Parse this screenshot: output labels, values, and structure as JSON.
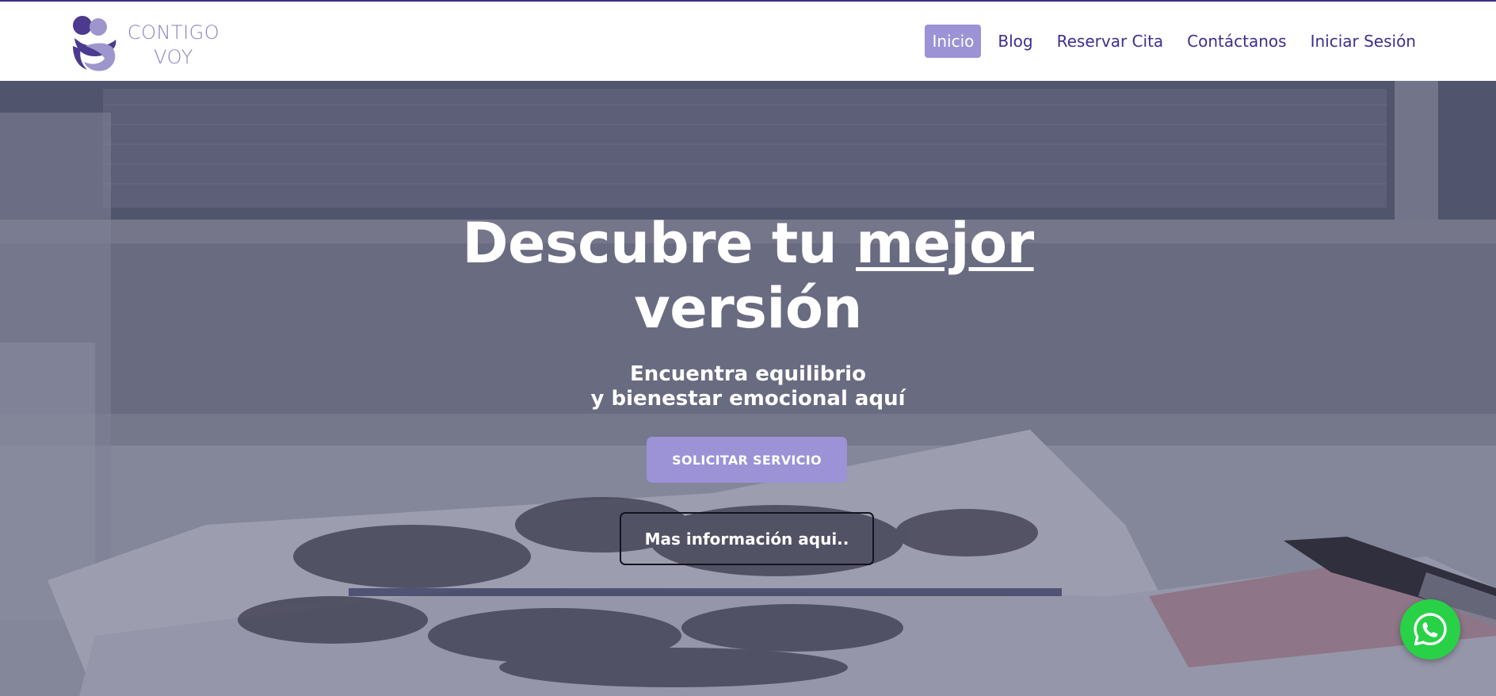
{
  "brand": {
    "line1": "CONTIGO",
    "line2": "VOY",
    "color": "#8a7fc2"
  },
  "nav": {
    "items": [
      {
        "label": "Inicio",
        "active": true
      },
      {
        "label": "Blog",
        "active": false
      },
      {
        "label": "Reservar Cita",
        "active": false
      },
      {
        "label": "Contáctanos",
        "active": false
      },
      {
        "label": "Iniciar Sesión",
        "active": false
      }
    ],
    "active_color": "#9b93d6",
    "text_color": "#3d2f8f"
  },
  "hero": {
    "headline_part1": "Descubre tu ",
    "headline_emphasis": "mejor",
    "headline_part2": "versión",
    "subline1": "Encuentra equilibrio",
    "subline2": "y bienestar emocional aquí",
    "primary_button": "SOLICITAR SERVICIO",
    "secondary_button": "Mas información aqui.."
  },
  "floating": {
    "whatsapp_icon": "whatsapp-icon",
    "color": "#28d146"
  }
}
